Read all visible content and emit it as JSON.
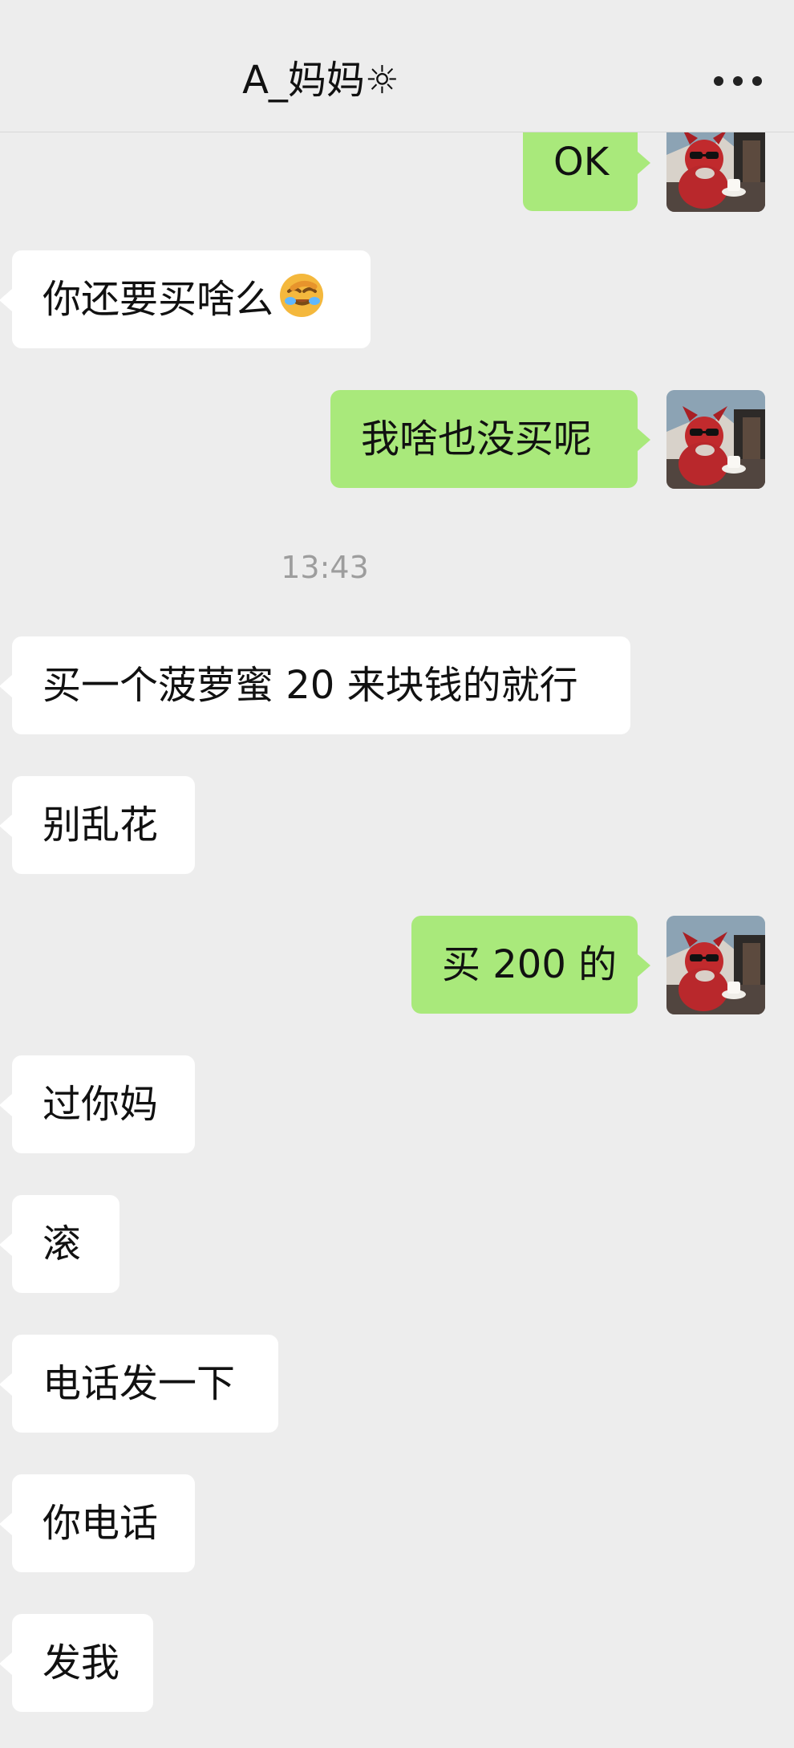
{
  "header": {
    "title": "A_妈妈☼",
    "more_label": "更多"
  },
  "chat": {
    "timestamp": "13:43",
    "messages": [
      {
        "side": "right",
        "text": "OK"
      },
      {
        "side": "left",
        "text": "你还要买啥么",
        "emoji": "face-palm-laugh-emoji"
      },
      {
        "side": "right",
        "text": "我啥也没买呢"
      },
      {
        "side": "left",
        "text": "买一个菠萝蜜 20 来块钱的就行"
      },
      {
        "side": "left",
        "text": "别乱花"
      },
      {
        "side": "right",
        "text": "买 200 的"
      },
      {
        "side": "left",
        "text": "过你妈"
      },
      {
        "side": "left",
        "text": "滚"
      },
      {
        "side": "left",
        "text": "电话发一下"
      },
      {
        "side": "left",
        "text": "你电话"
      },
      {
        "side": "left",
        "text": "发我"
      }
    ]
  },
  "colors": {
    "background": "#ededed",
    "right_bubble": "#a9e97b",
    "left_bubble": "#ffffff",
    "timestamp": "#9d9d9d"
  },
  "icons": {
    "more": "more-dots-icon",
    "avatar": "user-avatar"
  }
}
